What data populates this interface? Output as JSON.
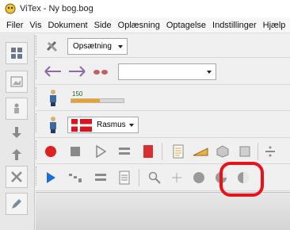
{
  "window": {
    "title": "ViTex - Ny bog.bog"
  },
  "menu": {
    "items": [
      "Filer",
      "Vis",
      "Dokument",
      "Side",
      "Oplæsning",
      "Optagelse",
      "Indstillinger",
      "Hjælp"
    ]
  },
  "toolbar1": {
    "setup_combo": "Opsætning"
  },
  "toolbar2": {
    "voice_combo": ""
  },
  "toolbar3": {
    "speed_value": "150"
  },
  "toolbar4": {
    "voice_name": "Rasmus"
  },
  "colors": {
    "accent_red": "#e8121a",
    "play_blue": "#1a6ed8",
    "record_red": "#e02020",
    "speed_bar": "#f0a020",
    "flag_red": "#d8141c"
  },
  "speed": {
    "fraction": 0.55
  }
}
